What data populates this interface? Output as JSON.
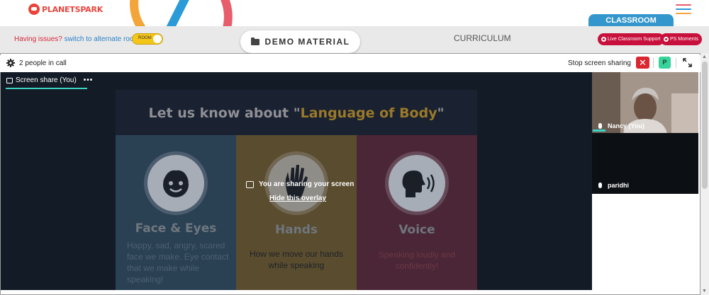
{
  "header": {
    "logo_text": "PLANETSPARK",
    "classroom_tab": "CLASSROOM"
  },
  "toolbar": {
    "issues_text": "Having issues?",
    "alternate_link": "switch to alternate room",
    "toggle_label": "ROOM",
    "demo_material": "DEMO MATERIAL",
    "curriculum": "CURRICULUM",
    "live_support": "Live Classroom Support",
    "ps_moments": "PS Moments"
  },
  "call": {
    "people_count": "2 people in call",
    "stop_share": "Stop screen sharing",
    "close_symbol": "✕",
    "participant_badge": "P",
    "share_tab_label": "Screen share (You)",
    "tab_menu": "•••"
  },
  "slide": {
    "title_prefix": "Let us know about \"",
    "title_highlight": "Language of Body",
    "title_suffix": "\"",
    "columns": [
      {
        "label": "Face & Eyes",
        "desc": "Happy, sad, angry, scared face we make. Eye contact that we make while speaking!",
        "icon": "face-icon"
      },
      {
        "label": "Hands",
        "desc": "How we move our hands while speaking",
        "icon": "hand-icon"
      },
      {
        "label": "Voice",
        "desc": "Speaking loudly and confidently!",
        "icon": "voice-icon"
      }
    ]
  },
  "overlay": {
    "message": "You are sharing your screen",
    "hide": "Hide this overlay"
  },
  "participants": [
    {
      "name": "Nancy (You)"
    },
    {
      "name": "paridhi"
    }
  ],
  "colors": {
    "brand_red": "#e8453c",
    "classroom_blue": "#3396cc",
    "pill_red": "#c8103c",
    "accent_teal": "#3dd2c3",
    "toggle_yellow": "#f5c518"
  }
}
